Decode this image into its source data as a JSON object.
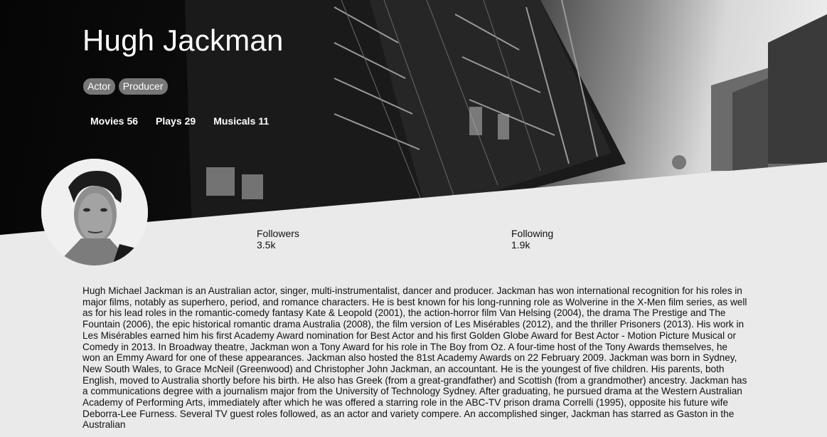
{
  "profile": {
    "name": "Hugh Jackman",
    "tags": [
      "Actor",
      "Producer"
    ],
    "stats": [
      {
        "label": "Movies",
        "value": "56"
      },
      {
        "label": "Plays",
        "value": "29"
      },
      {
        "label": "Musicals",
        "value": "11"
      }
    ],
    "followers_label": "Followers",
    "followers_value": "3.5k",
    "following_label": "Following",
    "following_value": "1.9k",
    "bio": "Hugh Michael Jackman is an Australian actor, singer, multi-instrumentalist, dancer and producer. Jackman has won international recognition for his roles in major films, notably as superhero, period, and romance characters. He is best known for his long-running role as Wolverine in the X-Men film series, as well as for his lead roles in the romantic-comedy fantasy Kate & Leopold (2001), the action-horror film Van Helsing (2004), the drama The Prestige and The Fountain (2006), the epic historical romantic drama Australia (2008), the film version of Les Misérables (2012), and the thriller Prisoners (2013). His work in Les Misérables earned him his first Academy Award nomination for Best Actor and his first Golden Globe Award for Best Actor - Motion Picture Musical or Comedy in 2013. In Broadway theatre, Jackman won a Tony Award for his role in The Boy from Oz. A four-time host of the Tony Awards themselves, he won an Emmy Award for one of these appearances. Jackman also hosted the 81st Academy Awards on 22 February 2009. Jackman was born in Sydney, New South Wales, to Grace McNeil (Greenwood) and Christopher John Jackman, an accountant. He is the youngest of five children. His parents, both English, moved to Australia shortly before his birth. He also has Greek (from a great-grandfather) and Scottish (from a grandmother) ancestry. Jackman has a communications degree with a journalism major from the University of Technology Sydney. After graduating, he pursued drama at the Western Australian Academy of Performing Arts, immediately after which he was offered a starring role in the ABC-TV prison drama Correlli (1995), opposite his future wife Deborra-Lee Furness. Several TV guest roles followed, as an actor and variety compere. An accomplished singer, Jackman has starred as Gaston in the Australian"
  },
  "colors": {
    "background": "#eaeaea",
    "tag_background": "#777777",
    "text": "#111111",
    "hero_text": "#ffffff"
  },
  "icons": [
    "avatar-photo",
    "cover-photo"
  ]
}
